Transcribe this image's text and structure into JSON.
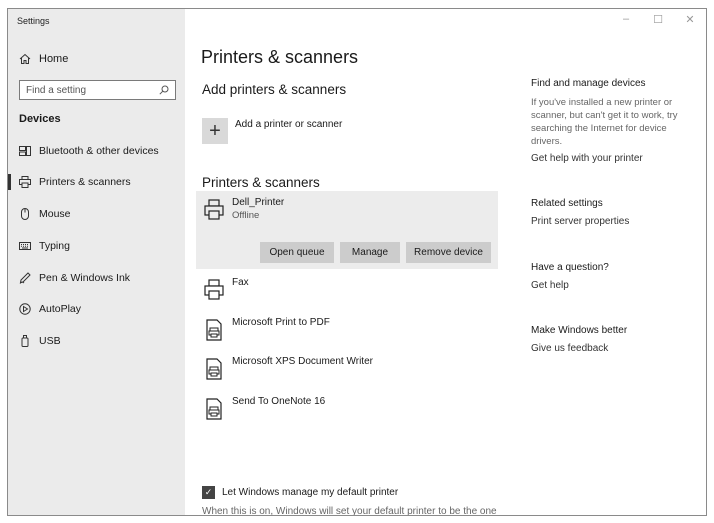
{
  "window": {
    "title": "Settings",
    "controls": {
      "minimize": "–",
      "maximize": "☐",
      "close": "✕"
    }
  },
  "sidebar": {
    "home_label": "Home",
    "search_placeholder": "Find a setting",
    "section_heading": "Devices",
    "items": [
      {
        "label": "Bluetooth & other devices",
        "icon": "keyboard-speaker-icon"
      },
      {
        "label": "Printers & scanners",
        "icon": "printer-icon",
        "active": true
      },
      {
        "label": "Mouse",
        "icon": "mouse-icon"
      },
      {
        "label": "Typing",
        "icon": "keyboard-icon"
      },
      {
        "label": "Pen & Windows Ink",
        "icon": "pen-icon"
      },
      {
        "label": "AutoPlay",
        "icon": "autoplay-icon"
      },
      {
        "label": "USB",
        "icon": "usb-icon"
      }
    ]
  },
  "main": {
    "title": "Printers & scanners",
    "add_heading": "Add printers & scanners",
    "add_label": "Add a printer or scanner",
    "list_heading": "Printers & scanners",
    "devices": [
      {
        "name": "Dell_Printer",
        "status": "Offline",
        "icon": "printer-icon"
      },
      {
        "name": "Fax",
        "icon": "printer-icon"
      },
      {
        "name": "Microsoft Print to PDF",
        "icon": "document-printer-icon"
      },
      {
        "name": "Microsoft XPS Document Writer",
        "icon": "document-printer-icon"
      },
      {
        "name": "Send To OneNote 16",
        "icon": "document-printer-icon"
      }
    ],
    "buttons": {
      "open_queue": "Open queue",
      "manage": "Manage",
      "remove": "Remove device"
    },
    "default_printer_checkbox": {
      "label": "Let Windows manage my default printer",
      "checked": true
    },
    "default_printer_description": "When this is on, Windows will set your default printer to be the one"
  },
  "right_panel": {
    "find_heading": "Find and manage devices",
    "find_text": "If you've installed a new printer or scanner, but can't get it to work, try searching the Internet for device drivers.",
    "find_link": "Get help with your printer",
    "related_heading": "Related settings",
    "related_link": "Print server properties",
    "question_heading": "Have a question?",
    "question_link": "Get help",
    "better_heading": "Make Windows better",
    "better_link": "Give us feedback"
  }
}
